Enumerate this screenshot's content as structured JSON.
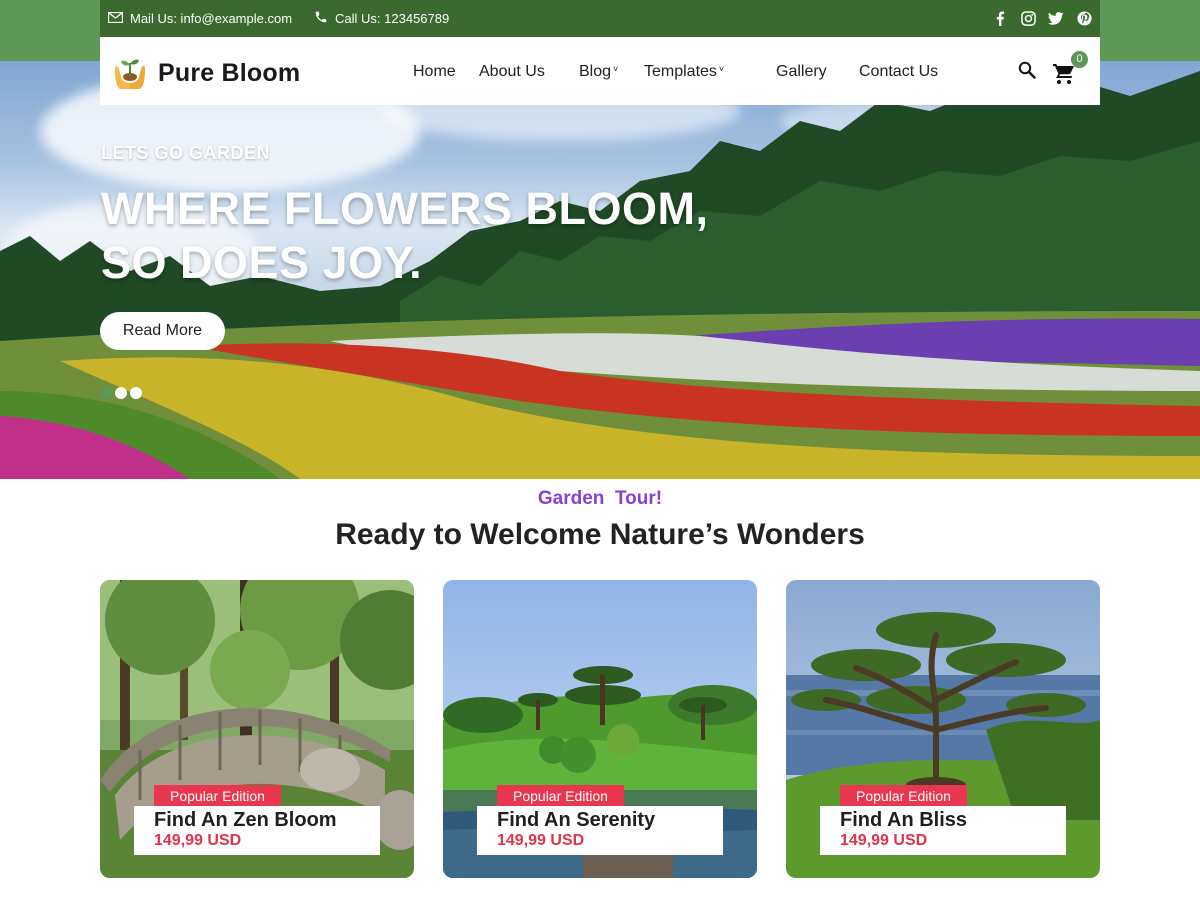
{
  "topbar": {
    "mail": "Mail Us: info@example.com",
    "phone": "Call Us: 123456789",
    "socials": [
      "facebook-icon",
      "instagram-icon",
      "twitter-icon",
      "pinterest-icon"
    ]
  },
  "brand": {
    "name": "Pure Bloom"
  },
  "nav": {
    "items": [
      {
        "label": "Home"
      },
      {
        "label": "About Us"
      },
      {
        "label": "Blog"
      },
      {
        "label": "Templates"
      },
      {
        "label": "Gallery"
      },
      {
        "label": "Contact Us"
      }
    ],
    "cart_count": "0"
  },
  "hero": {
    "kicker": "LETS GO GARDEN",
    "title_line1": "WHERE FLOWERS BLOOM,",
    "title_line2": "SO DOES JOY.",
    "button": "Read More",
    "slides": 3,
    "active_slide": 1
  },
  "section": {
    "kicker": "Garden  Tour!",
    "title": "Ready to Welcome Nature’s Wonders"
  },
  "cards": [
    {
      "badge": "Popular Edition",
      "title": "Find An Zen Bloom",
      "price": "149,99 USD"
    },
    {
      "badge": "Popular Edition",
      "title": "Find An Serenity",
      "price": "149,99 USD"
    },
    {
      "badge": "Popular Edition",
      "title": "Find An Bliss",
      "price": "149,99 USD"
    }
  ],
  "colors": {
    "brand_green": "#5c9856",
    "topbar_green": "#3a6a2e",
    "accent_purple": "#8a3fd1",
    "accent_red": "#e8374f"
  }
}
